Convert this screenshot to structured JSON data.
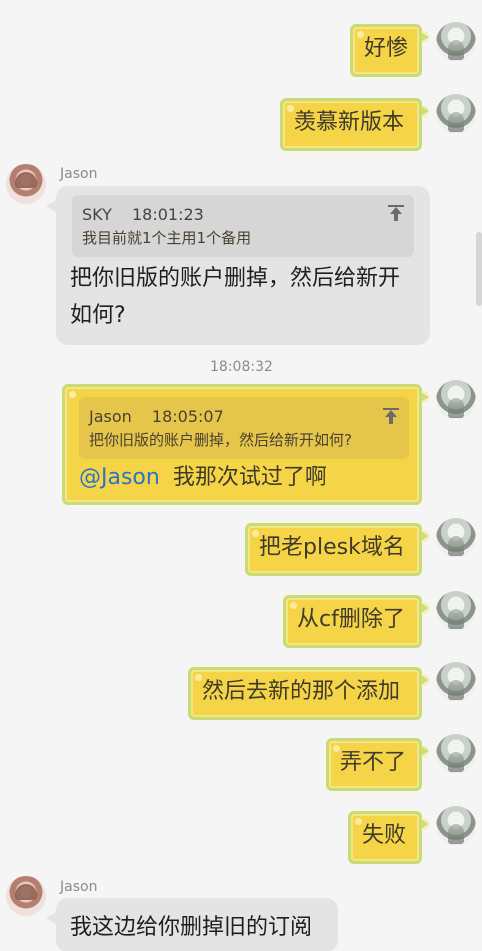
{
  "messages": {
    "out1": "好惨",
    "out2": "羡慕新版本",
    "in1_name": "Jason",
    "in1_quote_sender": "SKY",
    "in1_quote_time": "18:01:23",
    "in1_quote_text": "我目前就1个主用1个备用",
    "in1_text_line1": "把你旧版的账户删掉，然后给新开",
    "in1_text_line2": "如何?",
    "timestamp": "18:08:32",
    "out3_quote_sender": "Jason",
    "out3_quote_time": "18:05:07",
    "out3_quote_text": "把你旧版的账户删掉，然后给新开如何?",
    "out3_mention": "@Jason",
    "out3_text": "我那次试过了啊",
    "out4": "把老plesk域名",
    "out5": "从cf删除了",
    "out6": "然后去新的那个添加",
    "out7": "弄不了",
    "out8": "失败",
    "in2_name": "Jason",
    "in2_text": "我这边给你删掉旧的订阅"
  },
  "icons": {
    "avatar_sky": "anime-avatar",
    "avatar_jason": "anime-avatar",
    "pin": "top-arrow-icon"
  }
}
